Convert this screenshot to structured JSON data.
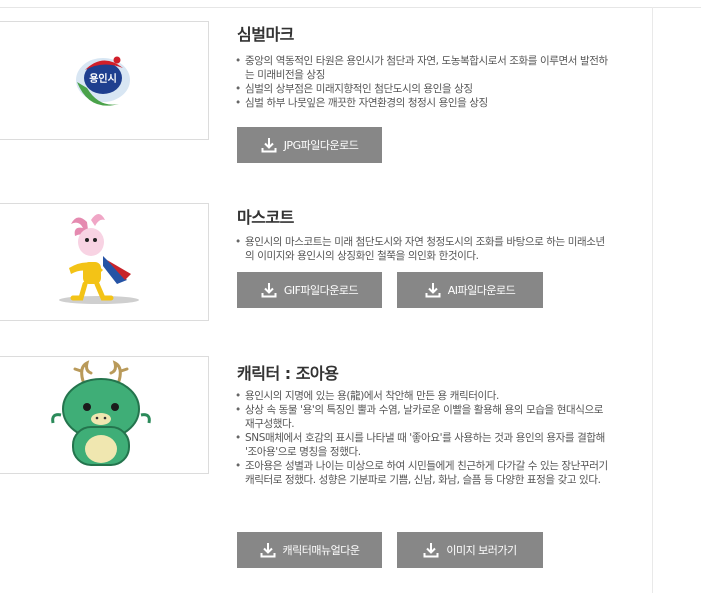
{
  "sections": [
    {
      "title": "심벌마크",
      "logo_text": "용인시",
      "items": [
        "중앙의 역동적인 타원은 용인시가 첨단과 자연, 도농복합시로서 조화를 이루면서 발전하는 미래비전을 상징",
        "심벌의 상부점은 미래지향적인 첨단도시의 용인을 상징",
        "심벌 하부 나뭇잎은 깨끗한 자연환경의 청정시 용인을 상징"
      ],
      "buttons": [
        "JPG파일다운로드"
      ]
    },
    {
      "title": "마스코트",
      "items": [
        "용인시의 마스코트는 미래 첨단도시와 자연 청정도시의 조화를 바탕으로 하는 미래소년의 이미지와 용인시의 상징화인 철쭉을 의인화 한것이다."
      ],
      "buttons": [
        "GIF파일다운로드",
        "AI파일다운로드"
      ]
    },
    {
      "title": "캐릭터 : 조아용",
      "items": [
        "용인시의 지명에 있는 용(龍)에서 착안해 만든 용 캐릭터이다.",
        "상상 속 동물 '용'의 특징인 뿔과 수염, 날카로운 이빨을 활용해 용의 모습을 현대식으로 재구성했다.",
        "SNS매체에서 호감의 표시를 나타낼 때 '좋아요'를 사용하는 것과 용인의 용자를 결합해 '조아용'으로 명칭을 정했다.",
        "조아용은 성별과 나이는 미상으로 하여 시민들에게 친근하게 다가갈 수 있는 장난꾸러기 캐릭터로 정했다. 성향은 기분파로 기쁨, 신남, 화남, 슬픔 등 다양한 표정을 갖고 있다."
      ],
      "buttons": [
        "캐릭터매뉴얼다운",
        "이미지 보러가기"
      ]
    }
  ],
  "colors": {
    "button_bg": "#878787",
    "title": "#333333",
    "text": "#555555",
    "border": "#dcdcdc"
  }
}
